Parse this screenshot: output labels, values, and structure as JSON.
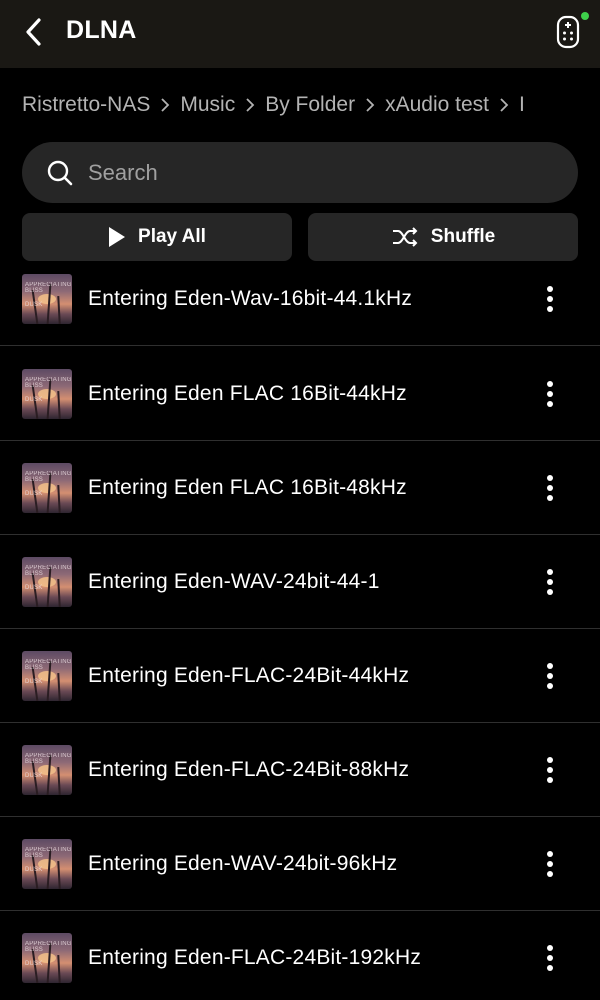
{
  "header": {
    "title": "DLNA",
    "back_icon": "chevron-left-icon",
    "remote_icon": "remote-control-icon",
    "status_dot_color": "#3ecf4b"
  },
  "breadcrumb": [
    "Ristretto-NAS",
    "Music",
    "By Folder",
    "xAudio test",
    "I"
  ],
  "search": {
    "placeholder": "Search",
    "value": ""
  },
  "actions": {
    "play_all_label": "Play All",
    "shuffle_label": "Shuffle"
  },
  "tracks": [
    {
      "title": "Entering Eden-Wav-16bit-44.1kHz"
    },
    {
      "title": "Entering Eden FLAC 16Bit-44kHz"
    },
    {
      "title": "Entering Eden FLAC 16Bit-48kHz"
    },
    {
      "title": "Entering Eden-WAV-24bit-44-1"
    },
    {
      "title": "Entering Eden-FLAC-24Bit-44kHz"
    },
    {
      "title": "Entering Eden-FLAC-24Bit-88kHz"
    },
    {
      "title": "Entering Eden-WAV-24bit-96kHz"
    },
    {
      "title": "Entering Eden-FLAC-24Bit-192kHz"
    }
  ],
  "album_art_text": [
    "APPRECIATING",
    "BLISS",
    "DUSK"
  ],
  "colors": {
    "background": "#000000",
    "header_bg": "#1a1814",
    "control_bg": "#262626",
    "divider": "#2f2f2f",
    "muted_text": "#b3b3b3"
  }
}
